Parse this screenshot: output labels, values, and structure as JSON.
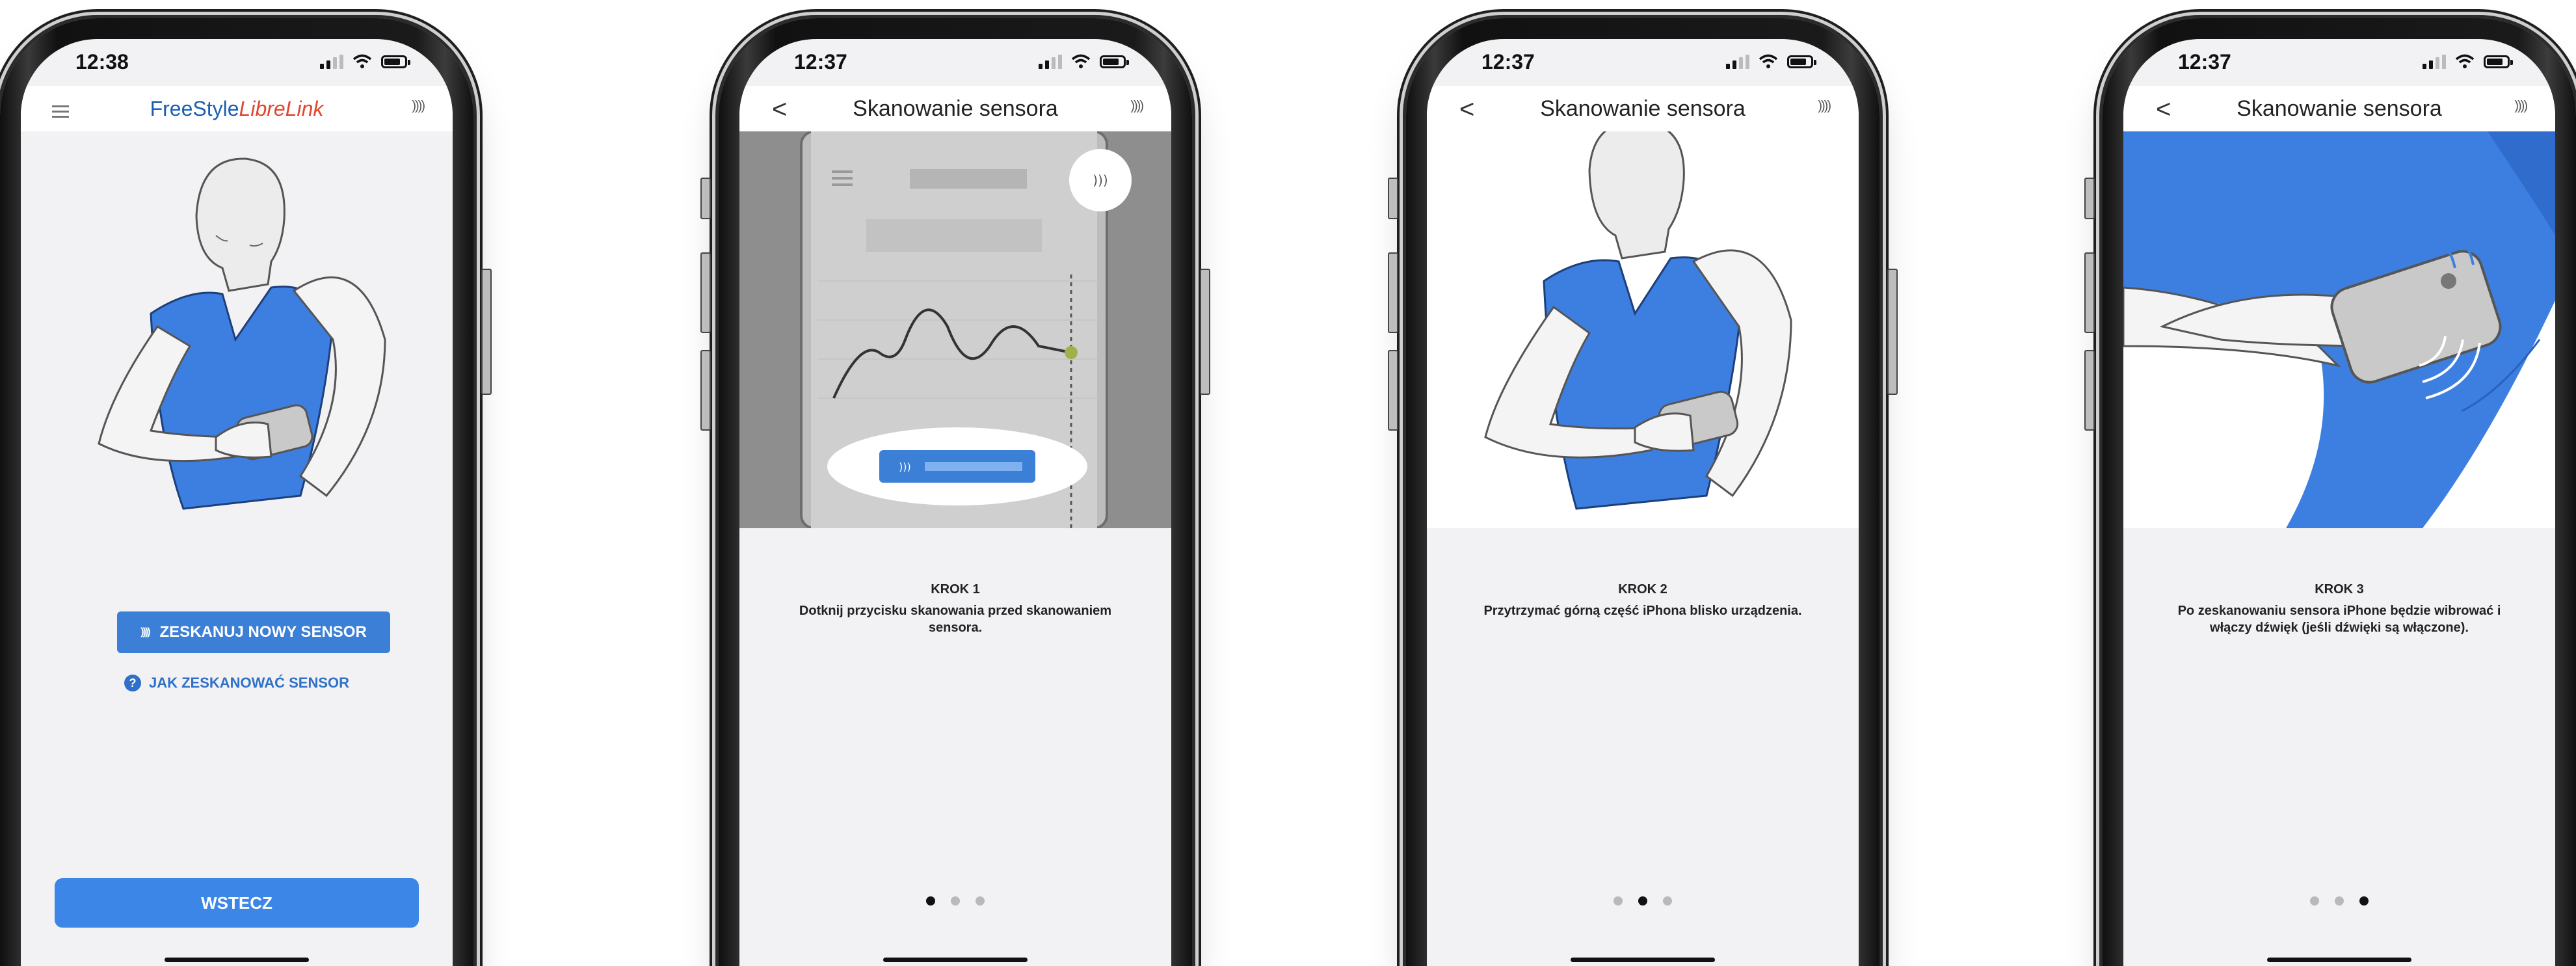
{
  "phones": [
    {
      "time": "12:38",
      "brand_a": "FreeStyle",
      "brand_b": "LibreLink",
      "scan_icon": "))))",
      "scan_button": "ZESKANUJ NOWY SENSOR",
      "help_link": "JAK ZESKANOWAĆ SENSOR",
      "back_button": "WSTECZ"
    },
    {
      "time": "12:37",
      "title": "Skanowanie sensora",
      "back_icon": "<",
      "scan_icon": "))))",
      "step_title": "KROK 1",
      "step_text": "Dotknij przycisku skanowania przed skanowaniem sensora.",
      "page": 1
    },
    {
      "time": "12:37",
      "title": "Skanowanie sensora",
      "back_icon": "<",
      "scan_icon": "))))",
      "step_title": "KROK 2",
      "step_text": "Przytrzymać górną część iPhona blisko urządzenia.",
      "page": 2
    },
    {
      "time": "12:37",
      "title": "Skanowanie sensora",
      "back_icon": "<",
      "scan_icon": "))))",
      "step_title": "KROK 3",
      "step_text": "Po zeskanowaniu sensora iPhone będzie wibrować i włączy dźwięk (jeśli dźwięki są włączone).",
      "page": 3
    }
  ],
  "colors": {
    "accent": "#3b7fd6",
    "shirt": "#3d7fe0",
    "brand_red": "#e1462f",
    "screen_bg": "#f2f2f4"
  },
  "icons": [
    "hamburger-menu-icon",
    "scan-nfc-icon",
    "back-chevron-icon",
    "help-icon",
    "signal-icon",
    "wifi-icon",
    "battery-icon"
  ]
}
